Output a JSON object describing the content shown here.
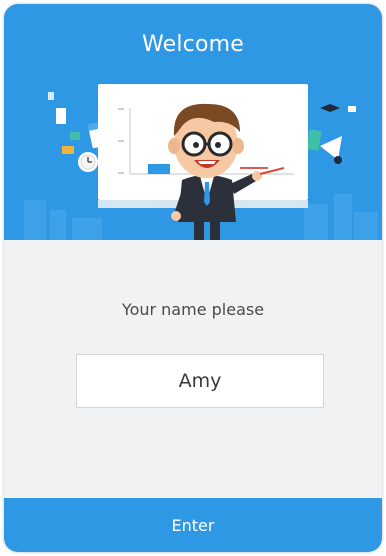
{
  "header": {
    "title": "Welcome"
  },
  "form": {
    "prompt": "Your name please",
    "name_value": "Amy"
  },
  "footer": {
    "enter_label": "Enter"
  },
  "colors": {
    "primary": "#2f98e4",
    "background": "#f1f2f4",
    "text": "#4a4a4a"
  },
  "icons": [
    "teacher-illustration",
    "whiteboard-chart",
    "calendar-icon",
    "book-stack-icon",
    "clock-icon",
    "graduation-cap-icon",
    "bell-icon"
  ]
}
